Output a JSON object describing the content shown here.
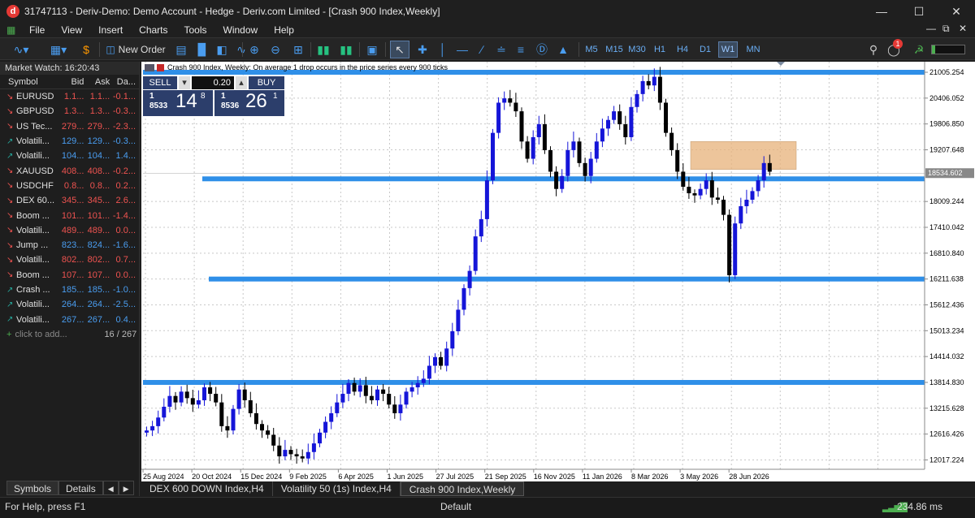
{
  "window": {
    "title": "31747113 - Deriv-Demo: Demo Account - Hedge - Deriv.com Limited - [Crash 900 Index,Weekly]",
    "app_icon_letter": "d"
  },
  "menu": [
    "File",
    "View",
    "Insert",
    "Charts",
    "Tools",
    "Window",
    "Help"
  ],
  "toolbar": {
    "new_order_label": "New Order",
    "timeframes": [
      "M5",
      "M15",
      "M30",
      "H1",
      "H4",
      "D1",
      "W1",
      "MN"
    ],
    "selected_timeframe": "W1",
    "notification_count": "1"
  },
  "market_watch": {
    "title": "Market Watch: 16:20:43",
    "headers": {
      "symbol": "Symbol",
      "bid": "Bid",
      "ask": "Ask",
      "daily": "Da..."
    },
    "rows": [
      {
        "dir": "down",
        "symbol": "EURUSD",
        "bid": "1.1...",
        "ask": "1.1...",
        "daily": "-0.1...",
        "color": "red"
      },
      {
        "dir": "down",
        "symbol": "GBPUSD",
        "bid": "1.3...",
        "ask": "1.3...",
        "daily": "-0.3...",
        "color": "red"
      },
      {
        "dir": "down",
        "symbol": "US Tec...",
        "bid": "279...",
        "ask": "279...",
        "daily": "-2.3...",
        "color": "red"
      },
      {
        "dir": "up",
        "symbol": "Volatili...",
        "bid": "129...",
        "ask": "129...",
        "daily": "-0.3...",
        "color": "blue"
      },
      {
        "dir": "up",
        "symbol": "Volatili...",
        "bid": "104...",
        "ask": "104...",
        "daily": "1.4...",
        "color": "blue"
      },
      {
        "dir": "down",
        "symbol": "XAUUSD",
        "bid": "408...",
        "ask": "408...",
        "daily": "-0.2...",
        "color": "red"
      },
      {
        "dir": "down",
        "symbol": "USDCHF",
        "bid": "0.8...",
        "ask": "0.8...",
        "daily": "0.2...",
        "color": "red"
      },
      {
        "dir": "down",
        "symbol": "DEX 60...",
        "bid": "345...",
        "ask": "345...",
        "daily": "2.6...",
        "color": "red"
      },
      {
        "dir": "down",
        "symbol": "Boom ...",
        "bid": "101...",
        "ask": "101...",
        "daily": "-1.4...",
        "color": "red"
      },
      {
        "dir": "down",
        "symbol": "Volatili...",
        "bid": "489...",
        "ask": "489...",
        "daily": "0.0...",
        "color": "red"
      },
      {
        "dir": "down",
        "symbol": "Jump ...",
        "bid": "823...",
        "ask": "824...",
        "daily": "-1.6...",
        "color": "blue"
      },
      {
        "dir": "down",
        "symbol": "Volatili...",
        "bid": "802...",
        "ask": "802...",
        "daily": "0.7...",
        "color": "red"
      },
      {
        "dir": "down",
        "symbol": "Boom ...",
        "bid": "107...",
        "ask": "107...",
        "daily": "0.0...",
        "color": "red"
      },
      {
        "dir": "up",
        "symbol": "Crash ...",
        "bid": "185...",
        "ask": "185...",
        "daily": "-1.0...",
        "color": "blue"
      },
      {
        "dir": "up",
        "symbol": "Volatili...",
        "bid": "264...",
        "ask": "264...",
        "daily": "-2.5...",
        "color": "blue"
      },
      {
        "dir": "up",
        "symbol": "Volatili...",
        "bid": "267...",
        "ask": "267...",
        "daily": "0.4...",
        "color": "blue"
      }
    ],
    "add_label": "click to add...",
    "count": "16 / 267",
    "tabs": [
      "Symbols",
      "Details"
    ]
  },
  "chart": {
    "header_text": "Crash 900 Index, Weekly:  On average 1 drop occurs in the price series every 900 ticks",
    "sell_label": "SELL",
    "buy_label": "BUY",
    "lot": "0.20",
    "sell_price_small": "1\n8533",
    "sell_price_big": "14",
    "sell_price_sup": "8",
    "buy_price_small": "1\n8536",
    "buy_price_big": "26",
    "buy_price_sup": "1",
    "current_price_label": "18534.602",
    "price_ticks": [
      "21005.254",
      "20406.052",
      "19806.850",
      "19207.648",
      "18009.244",
      "17410.042",
      "16810.840",
      "16211.638",
      "15612.436",
      "15013.234",
      "14414.032",
      "13814.830",
      "13215.628",
      "12616.426",
      "12017.224"
    ],
    "date_ticks": [
      "25 Aug 2024",
      "20 Oct 2024",
      "15 Dec 2024",
      "9 Feb 2025",
      "6 Apr 2025",
      "1 Jun 2025",
      "27 Jul 2025",
      "21 Sep 2025",
      "16 Nov 2025",
      "11 Jan 2026",
      "8 Mar 2026",
      "3 May 2026",
      "28 Jun 2026"
    ],
    "tabs": [
      "DEX 600 DOWN Index,H4",
      "Volatility 50 (1s) Index,H4",
      "Crash 900 Index,Weekly"
    ],
    "active_tab": "Crash 900 Index,Weekly",
    "colors": {
      "bull": "#1515d8",
      "bear": "#000000",
      "hline": "#2f8fe8",
      "zone": "#e8b27a"
    }
  },
  "chart_data": {
    "type": "candlestick",
    "title": "Crash 900 Index, Weekly",
    "ylim": [
      11800,
      21250
    ],
    "horizontal_levels": [
      21005,
      18534,
      16211,
      13814
    ],
    "zone": {
      "from_date": "10 May 2026",
      "to_date": "30 Aug 2026",
      "low": 18750,
      "high": 19400
    }
  },
  "status": {
    "help_text": "For Help, press F1",
    "profile": "Default",
    "traffic": "234.86 ms"
  }
}
